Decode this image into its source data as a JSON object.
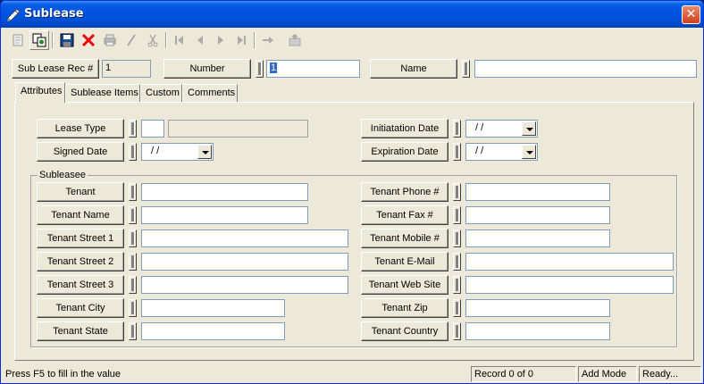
{
  "window": {
    "title": "Sublease",
    "close_symbol": "✕"
  },
  "toolbar": {
    "buttons": [
      {
        "icon": "new-record-icon",
        "enabled": false
      },
      {
        "icon": "copy-record-icon",
        "enabled": true
      },
      {
        "icon": "save-icon",
        "enabled": true
      },
      {
        "icon": "delete-icon",
        "enabled": true
      },
      {
        "icon": "print-icon",
        "enabled": false
      },
      {
        "icon": "edit-icon",
        "enabled": false
      },
      {
        "icon": "cut-icon",
        "enabled": false
      },
      {
        "icon": "first-record-icon",
        "enabled": false
      },
      {
        "icon": "previous-record-icon",
        "enabled": false
      },
      {
        "icon": "next-record-icon",
        "enabled": false
      },
      {
        "icon": "last-record-icon",
        "enabled": false
      },
      {
        "icon": "go-to-icon",
        "enabled": false
      },
      {
        "icon": "export-icon",
        "enabled": false
      }
    ]
  },
  "header": {
    "rec_label": "Sub Lease Rec #",
    "rec_value": "1",
    "number_label": "Number",
    "number_value": "1",
    "name_label": "Name",
    "name_value": ""
  },
  "tabs": [
    {
      "label": "Attributes",
      "active": true
    },
    {
      "label": "Sublease Items",
      "active": false
    },
    {
      "label": "Custom",
      "active": false
    },
    {
      "label": "Comments",
      "active": false
    }
  ],
  "attributes": {
    "lease_type_label": "Lease Type",
    "lease_type_code": "",
    "lease_type_desc": "",
    "signed_date_label": "Signed Date",
    "signed_date_value": "/  /",
    "initiation_date_label": "Initiatation Date",
    "initiation_date_value": "/  /",
    "expiration_date_label": "Expiration Date",
    "expiration_date_value": "/  /"
  },
  "sublessee": {
    "group_label": "Subleasee",
    "left_fields": [
      {
        "label": "Tenant",
        "value": ""
      },
      {
        "label": "Tenant Name",
        "value": ""
      },
      {
        "label": "Tenant Street 1",
        "value": ""
      },
      {
        "label": "Tenant Street 2",
        "value": ""
      },
      {
        "label": "Tenant Street 3",
        "value": ""
      },
      {
        "label": "Tenant City",
        "value": ""
      },
      {
        "label": "Tenant State",
        "value": ""
      }
    ],
    "right_fields": [
      {
        "label": "Tenant Phone #",
        "value": ""
      },
      {
        "label": "Tenant Fax #",
        "value": ""
      },
      {
        "label": "Tenant Mobile #",
        "value": ""
      },
      {
        "label": "Tenant E-Mail",
        "value": ""
      },
      {
        "label": "Tenant Web Site",
        "value": ""
      },
      {
        "label": "Tenant Zip",
        "value": ""
      },
      {
        "label": "Tenant Country",
        "value": ""
      }
    ]
  },
  "status": {
    "hint": "Press F5 to fill in the value",
    "record": "Record 0 of 0",
    "mode": "Add Mode",
    "state": "Ready..."
  }
}
